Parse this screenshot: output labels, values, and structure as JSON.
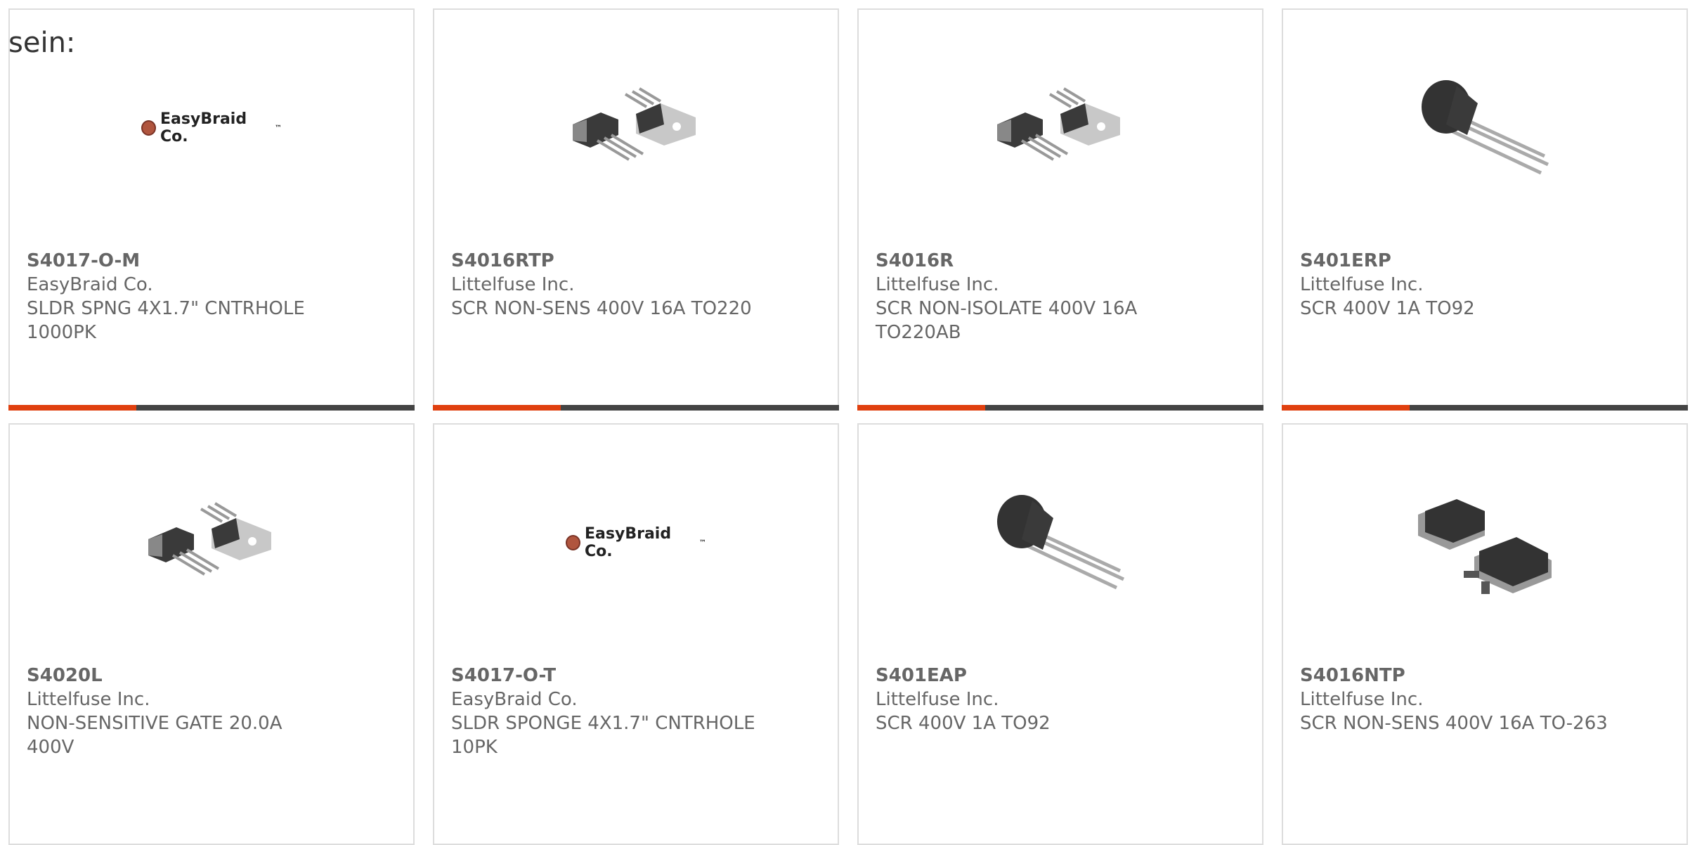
{
  "lead_text": "sein:",
  "products": [
    {
      "part": "S4017-O-M",
      "maker": "EasyBraid Co.",
      "desc": "SLDR SPNG 4X1.7\" CNTRHOLE\n1000PK",
      "image": "easybraid-logo"
    },
    {
      "part": "S4016RTP",
      "maker": "Littelfuse Inc.",
      "desc": "SCR NON-SENS 400V 16A TO220",
      "image": "to220-package"
    },
    {
      "part": "S4016R",
      "maker": "Littelfuse Inc.",
      "desc": "SCR NON-ISOLATE 400V 16A\nTO220AB",
      "image": "to220-package"
    },
    {
      "part": "S401ERP",
      "maker": "Littelfuse Inc.",
      "desc": "SCR 400V 1A TO92",
      "image": "to92-package"
    },
    {
      "part": "S4020L",
      "maker": "Littelfuse Inc.",
      "desc": "NON-SENSITIVE GATE 20.0A\n400V",
      "image": "to220-package"
    },
    {
      "part": "S4017-O-T",
      "maker": "EasyBraid Co.",
      "desc": "SLDR SPONGE 4X1.7\" CNTRHOLE\n10PK",
      "image": "easybraid-logo"
    },
    {
      "part": "S401EAP",
      "maker": "Littelfuse Inc.",
      "desc": "SCR 400V 1A TO92",
      "image": "to92-package"
    },
    {
      "part": "S4016NTP",
      "maker": "Littelfuse Inc.",
      "desc": "SCR NON-SENS 400V 16A TO-263",
      "image": "to263-package"
    }
  ],
  "logo_text": "EasyBraid Co.",
  "colors": {
    "accent": "#e0400f",
    "bar": "#444444",
    "border": "#dddddd",
    "text": "#666666"
  }
}
